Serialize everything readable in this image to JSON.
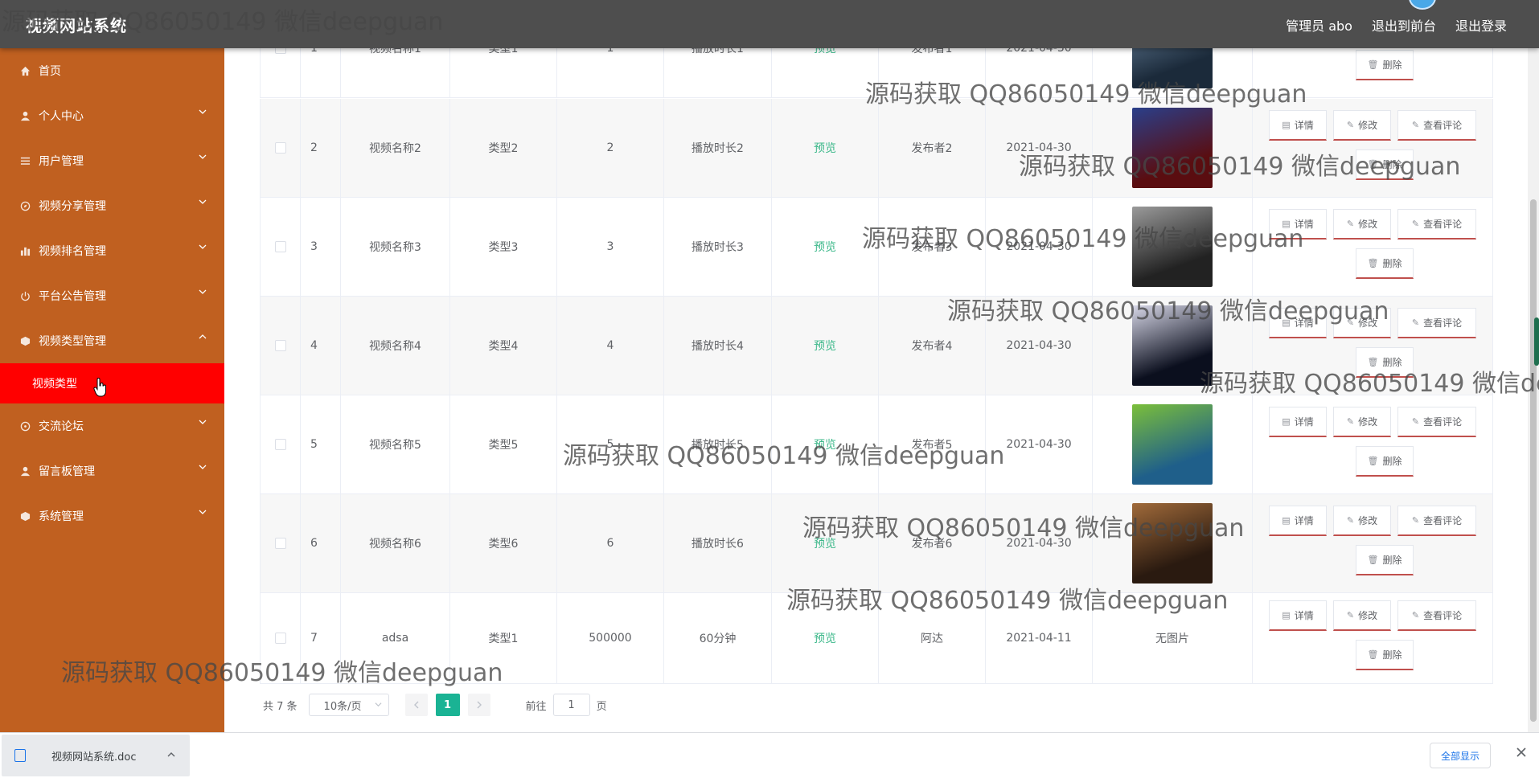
{
  "header": {
    "app_title": "视频网站系统",
    "admin_label": "管理员 abo",
    "back_front_label": "退出到前台",
    "logout_label": "退出登录"
  },
  "sidebar": {
    "items": [
      {
        "label": "首页",
        "icon": "home-icon",
        "has_children": false
      },
      {
        "label": "个人中心",
        "icon": "user-icon",
        "has_children": true
      },
      {
        "label": "用户管理",
        "icon": "list-icon",
        "has_children": true
      },
      {
        "label": "视频分享管理",
        "icon": "compass-icon",
        "has_children": true
      },
      {
        "label": "视频排名管理",
        "icon": "chart-icon",
        "has_children": true
      },
      {
        "label": "平台公告管理",
        "icon": "power-icon",
        "has_children": true
      },
      {
        "label": "视频类型管理",
        "icon": "cube-icon",
        "has_children": true,
        "expanded": true
      },
      {
        "label": "交流论坛",
        "icon": "chat-icon",
        "has_children": true
      },
      {
        "label": "留言板管理",
        "icon": "user-icon",
        "has_children": true
      },
      {
        "label": "系统管理",
        "icon": "cube-icon",
        "has_children": true
      }
    ],
    "active_submenu": "视频类型"
  },
  "table": {
    "rows": [
      {
        "index": "1",
        "name": "视频名称1",
        "type": "类型1",
        "count": "1",
        "duration": "播放时长1",
        "preview": "预览",
        "publisher": "发布者1",
        "date": "2021-04-30",
        "image": "poster-1"
      },
      {
        "index": "2",
        "name": "视频名称2",
        "type": "类型2",
        "count": "2",
        "duration": "播放时长2",
        "preview": "预览",
        "publisher": "发布者2",
        "date": "2021-04-30",
        "image": "poster-2"
      },
      {
        "index": "3",
        "name": "视频名称3",
        "type": "类型3",
        "count": "3",
        "duration": "播放时长3",
        "preview": "预览",
        "publisher": "发布者3",
        "date": "2021-04-30",
        "image": "poster-3"
      },
      {
        "index": "4",
        "name": "视频名称4",
        "type": "类型4",
        "count": "4",
        "duration": "播放时长4",
        "preview": "预览",
        "publisher": "发布者4",
        "date": "2021-04-30",
        "image": "poster-4"
      },
      {
        "index": "5",
        "name": "视频名称5",
        "type": "类型5",
        "count": "5",
        "duration": "播放时长5",
        "preview": "预览",
        "publisher": "发布者5",
        "date": "2021-04-30",
        "image": "poster-5"
      },
      {
        "index": "6",
        "name": "视频名称6",
        "type": "类型6",
        "count": "6",
        "duration": "播放时长6",
        "preview": "预览",
        "publisher": "发布者6",
        "date": "2021-04-30",
        "image": "poster-6"
      },
      {
        "index": "7",
        "name": "adsa",
        "type": "类型1",
        "count": "500000",
        "duration": "60分钟",
        "preview": "预览",
        "publisher": "阿达",
        "date": "2021-04-11",
        "image_text": "无图片"
      }
    ],
    "actions": {
      "detail": "详情",
      "edit": "修改",
      "comments": "查看评论",
      "delete": "删除"
    }
  },
  "pagination": {
    "total": "共 7 条",
    "page_size": "10条/页",
    "current_page": "1",
    "goto_label": "前往",
    "goto_value": "1",
    "page_unit": "页"
  },
  "download_bar": {
    "file_name": "视频网站系统.doc",
    "show_all": "全部显示"
  },
  "watermark": "源码获取 QQ86050149 微信deepguan",
  "colors": {
    "sidebar_bg": "#c06020",
    "topbar_bg": "#4e4e4e",
    "active_submenu_bg": "#ff0000",
    "preview_link": "#3cb88a",
    "pager_active": "#1ab394",
    "button_underline": "#c0504d"
  }
}
